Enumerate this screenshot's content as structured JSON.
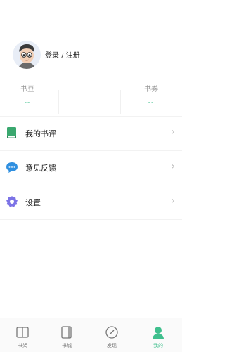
{
  "profile": {
    "login_label": "登录 / 注册"
  },
  "stats": [
    {
      "label": "书豆",
      "value": "--"
    },
    {
      "label": "书券",
      "value": "--"
    }
  ],
  "menu": [
    {
      "label": "我的书评",
      "icon": "book-icon"
    },
    {
      "label": "意见反馈",
      "icon": "chat-bubble-icon"
    },
    {
      "label": "设置",
      "icon": "gear-icon"
    }
  ],
  "tabbar": [
    {
      "label": "书架",
      "icon": "bookshelf-icon"
    },
    {
      "label": "书城",
      "icon": "book-store-icon"
    },
    {
      "label": "发现",
      "icon": "compass-icon"
    },
    {
      "label": "我的",
      "icon": "person-icon"
    }
  ],
  "colors": {
    "accent": "#3fbf8d",
    "book_icon": "#3aa86f",
    "chat_icon": "#2f8fe0",
    "gear_icon": "#7c73e6"
  }
}
